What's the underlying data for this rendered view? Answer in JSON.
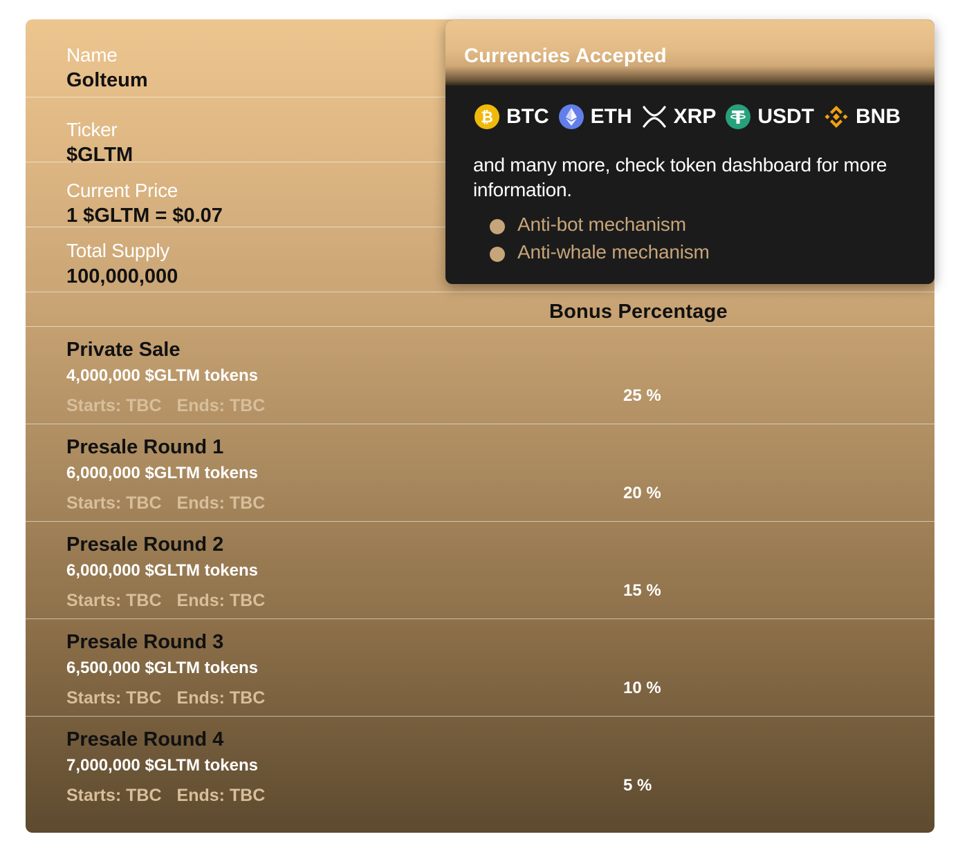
{
  "info": [
    {
      "label": "Name",
      "value": "Golteum"
    },
    {
      "label": "Ticker",
      "value": "$GLTM"
    },
    {
      "label": "Current Price",
      "value": "1 $GLTM = $0.07"
    },
    {
      "label": "Total Supply",
      "value": "100,000,000"
    }
  ],
  "bonus_header": "Bonus Percentage",
  "sales": [
    {
      "name": "Private Sale",
      "tokens": "4,000,000 $GLTM tokens",
      "starts": "Starts: TBC",
      "ends": "Ends: TBC",
      "bonus": "25 %"
    },
    {
      "name": "Presale Round 1",
      "tokens": "6,000,000 $GLTM tokens",
      "starts": "Starts: TBC",
      "ends": "Ends: TBC",
      "bonus": "20 %"
    },
    {
      "name": "Presale Round 2",
      "tokens": "6,000,000 $GLTM tokens",
      "starts": "Starts: TBC",
      "ends": "Ends: TBC",
      "bonus": "15 %"
    },
    {
      "name": "Presale Round 3",
      "tokens": "6,500,000 $GLTM tokens",
      "starts": "Starts: TBC",
      "ends": "Ends: TBC",
      "bonus": "10 %"
    },
    {
      "name": "Presale Round 4",
      "tokens": "7,000,000 $GLTM tokens",
      "starts": "Starts: TBC",
      "ends": "Ends: TBC",
      "bonus": "5 %"
    }
  ],
  "popup": {
    "title": "Currencies Accepted",
    "currencies": [
      {
        "code": "BTC",
        "icon": "bitcoin-icon",
        "color": "#f0b90b"
      },
      {
        "code": "ETH",
        "icon": "ethereum-icon",
        "color": "#627eea"
      },
      {
        "code": "XRP",
        "icon": "xrp-icon",
        "color": "#ffffff"
      },
      {
        "code": "USDT",
        "icon": "tether-icon",
        "color": "#26a17b"
      },
      {
        "code": "BNB",
        "icon": "binance-icon",
        "color": "#f3a012"
      }
    ],
    "description": "and many more, check token dashboard for more information.",
    "features": [
      "Anti-bot mechanism",
      "Anti-whale mechanism"
    ]
  },
  "colors": {
    "card_top": "#ecc58f",
    "card_bottom": "#5d4a2f",
    "popup_bg": "#1b1b1b",
    "accent_tan": "#c6a57a"
  }
}
